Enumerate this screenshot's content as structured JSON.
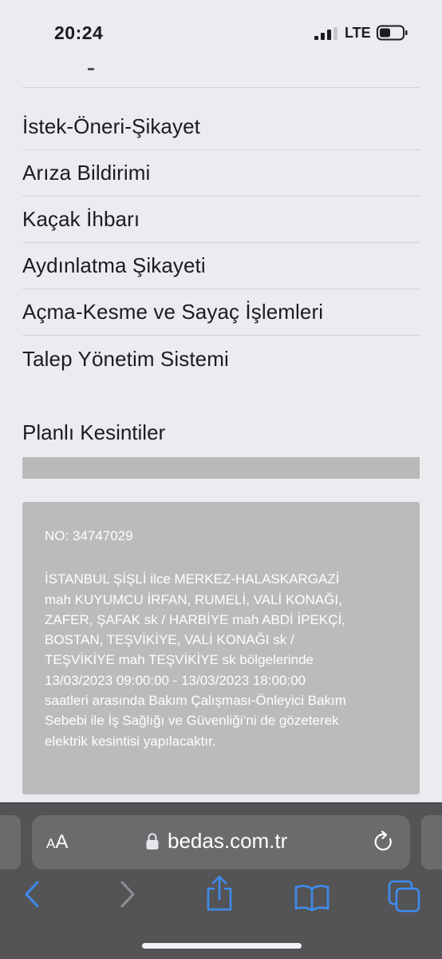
{
  "status_bar": {
    "time": "20:24",
    "network": "LTE",
    "icons": [
      "cellular-signal-icon",
      "battery-icon"
    ]
  },
  "header": {
    "dash": "-"
  },
  "menu": {
    "items": [
      {
        "label": "İstek-Öneri-Şikayet"
      },
      {
        "label": "Arıza Bildirimi"
      },
      {
        "label": "Kaçak İhbarı"
      },
      {
        "label": "Aydınlatma Şikayeti"
      },
      {
        "label": "Açma-Kesme ve Sayaç İşlemleri"
      },
      {
        "label": "Talep Yönetim Sistemi"
      }
    ]
  },
  "outages": {
    "title": "Planlı Kesintiler",
    "notice": {
      "number": "NO: 34747029",
      "lines": [
        "İSTANBUL ŞİŞLİ ilce MERKEZ-HALASKARGAZİ",
        "mah KUYUMCU İRFAN, RUMELİ, VALİ KONAĞI,",
        "ZAFER, ŞAFAK sk / HARBİYE mah ABDİ İPEKÇİ,",
        "BOSTAN, TEŞVİKİYE, VALİ KONAĞI sk /",
        "TEŞVİKİYE mah TEŞVİKİYE sk bölgelerinde",
        "13/03/2023 09:00:00 - 13/03/2023 18:00:00",
        "saatleri arasında Bakım Çalışması-Önleyici Bakım",
        "Sebebi ile İş Sağlığı ve Güvenliği’ni de gözeterek",
        "elektrik kesintisi yapılacaktır."
      ]
    }
  },
  "browser": {
    "aa_small": "A",
    "aa_large": "A",
    "domain": "bedas.com.tr",
    "toolbar": [
      "back-icon",
      "forward-icon",
      "share-icon",
      "bookmarks-icon",
      "tabs-icon"
    ]
  },
  "colors": {
    "page_background": "#ebebf0",
    "notice_background": "#bbbbbb",
    "browser_bar": "#545456",
    "toolbar_active": "#3d8cf0",
    "toolbar_disabled": "#8e8e93"
  }
}
